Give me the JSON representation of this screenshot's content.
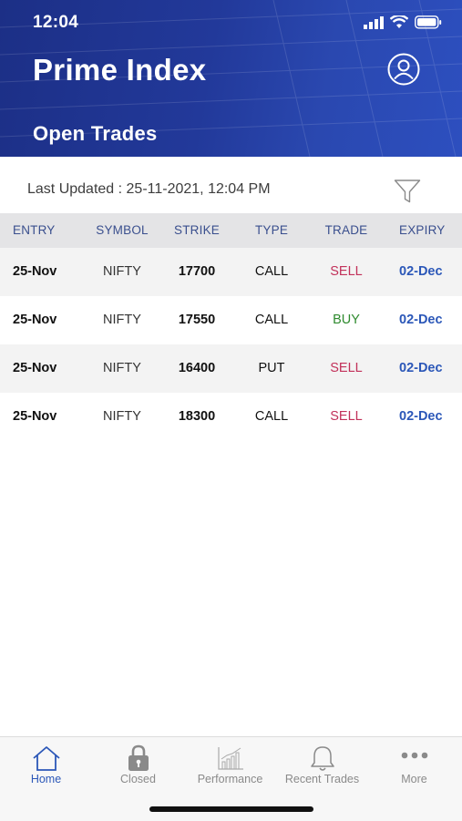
{
  "status_bar": {
    "time": "12:04"
  },
  "header": {
    "title": "Prime Index",
    "subtitle": "Open Trades"
  },
  "last_updated": "Last Updated : 25-11-2021, 12:04 PM",
  "table": {
    "columns": [
      "ENTRY",
      "SYMBOL",
      "STRIKE",
      "TYPE",
      "TRADE",
      "EXPIRY"
    ],
    "rows": [
      {
        "entry": "25-Nov",
        "symbol": "NIFTY",
        "strike": "17700",
        "type": "CALL",
        "trade": "SELL",
        "expiry": "02-Dec"
      },
      {
        "entry": "25-Nov",
        "symbol": "NIFTY",
        "strike": "17550",
        "type": "CALL",
        "trade": "BUY",
        "expiry": "02-Dec"
      },
      {
        "entry": "25-Nov",
        "symbol": "NIFTY",
        "strike": "16400",
        "type": "PUT",
        "trade": "SELL",
        "expiry": "02-Dec"
      },
      {
        "entry": "25-Nov",
        "symbol": "NIFTY",
        "strike": "18300",
        "type": "CALL",
        "trade": "SELL",
        "expiry": "02-Dec"
      }
    ]
  },
  "tabs": [
    {
      "label": "Home",
      "icon": "home-icon",
      "active": true
    },
    {
      "label": "Closed",
      "icon": "lock-icon",
      "active": false
    },
    {
      "label": "Performance",
      "icon": "chart-icon",
      "active": false
    },
    {
      "label": "Recent Trades",
      "icon": "bell-icon",
      "active": false
    },
    {
      "label": "More",
      "icon": "more-icon",
      "active": false
    }
  ],
  "colors": {
    "header": "#22399a",
    "sell": "#c2315a",
    "buy": "#2e8a2e",
    "expiry": "#2b57b8",
    "active_tab": "#2b57b8"
  }
}
